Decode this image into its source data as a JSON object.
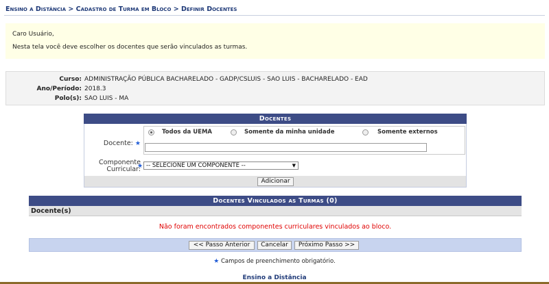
{
  "breadcrumb": {
    "part1": "Ensino a Distância",
    "sep1": " > ",
    "part2": "Cadastro de Turma em Bloco",
    "sep2": " > ",
    "part3": "Definir Docentes"
  },
  "notice": {
    "greeting": "Caro Usuário,",
    "message": "Nesta tela você deve escolher os docentes que serão vinculados as turmas."
  },
  "info": {
    "curso_label": "Curso:",
    "curso_value": "ADMINISTRAÇÃO PÚBLICA BACHARELADO - GADP/CSLUIS - SAO LUIS - BACHARELADO - EAD",
    "periodo_label": "Ano/Período:",
    "periodo_value": "2018.3",
    "polo_label": "Polo(s):",
    "polo_value": "SAO LUIS - MA"
  },
  "form": {
    "caption": "Docentes",
    "docente_label": "Docente:",
    "required_mark": "★",
    "radio_options": [
      {
        "label": "Todos da UEMA",
        "checked": true
      },
      {
        "label": "Somente da minha unidade",
        "checked": false
      },
      {
        "label": "Somente externos",
        "checked": false
      }
    ],
    "docente_input_value": "",
    "componente_label_line1": "Componente",
    "componente_label_line2": "Curricular:",
    "componente_select_value": "-- SELECIONE UM COMPONENTE --",
    "add_button": "Adicionar"
  },
  "vinculados": {
    "caption": "Docentes Vinculados as Turmas (0)",
    "column_header": "Docente(s)",
    "empty_message": "Não foram encontrados componentes curriculares vinculados ao bloco.",
    "prev_button": "<< Passo Anterior",
    "cancel_button": "Cancelar",
    "next_button": "Próximo Passo >>"
  },
  "footnote": {
    "star": "★",
    "text": " Campos de preenchimento obrigatório."
  },
  "footer_link": "Ensino a Distância",
  "colors": {
    "header_blue": "#3d4c86",
    "breadcrumb_blue": "#1f3a78",
    "notice_bg": "#ffffe6",
    "error_red": "#e00000",
    "nav_bg": "#c8d4ef"
  }
}
